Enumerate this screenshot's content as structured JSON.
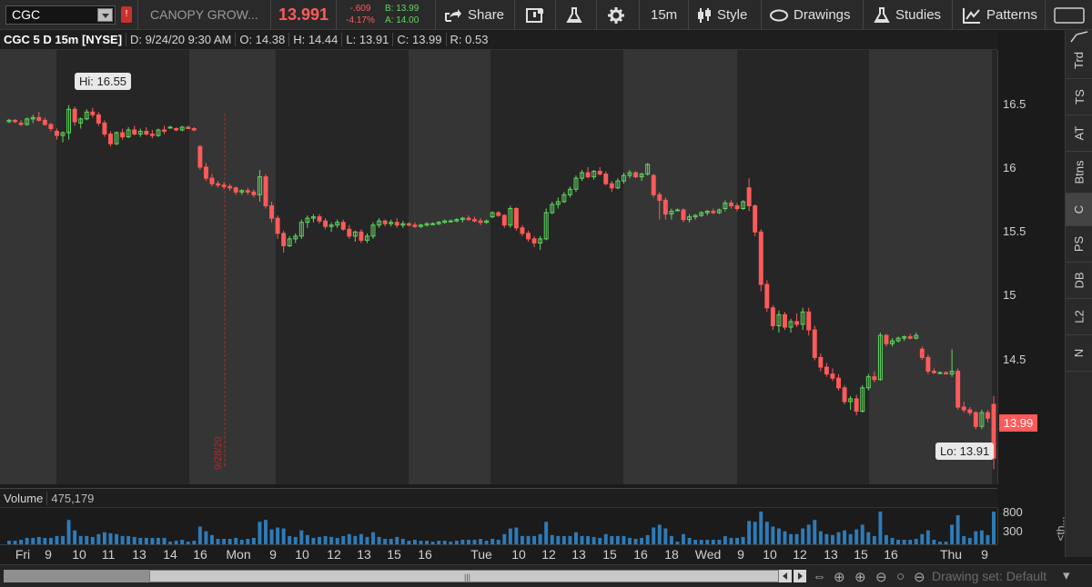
{
  "toolbar": {
    "symbol": "CGC",
    "company": "CANOPY GROW...",
    "last_price": "13.991",
    "change": "-.609",
    "change_pct": "-4.17%",
    "bid": "B: 13.99",
    "ask": "A: 14.00",
    "share_label": "Share",
    "interval_label": "15m",
    "style_label": "Style",
    "drawings_label": "Drawings",
    "studies_label": "Studies",
    "patterns_label": "Patterns",
    "colors": {
      "up": "#5fd85f",
      "down": "#ff5a5a"
    }
  },
  "infobar": {
    "symbol": "CGC 5 D 15m [NYSE]",
    "date": "D: 9/24/20 9:30 AM",
    "open": "O: 14.38",
    "high": "H: 14.44",
    "low": "L: 13.91",
    "close": "C: 13.99",
    "range": "R: 0.53"
  },
  "right_rail": [
    "Trd",
    "TS",
    "AT",
    "Btns",
    "C",
    "PS",
    "DB",
    "L2",
    "N"
  ],
  "price_axis": [
    "16.5",
    "16",
    "15.5",
    "15",
    "14.5"
  ],
  "price_flag": "13.99",
  "hi_label": "Hi: 16.55",
  "lo_label": "Lo: 13.91",
  "date_marker": "9/28/20",
  "volume": {
    "label": "Volume",
    "value": "475,179",
    "axis": [
      "800",
      "300"
    ],
    "collapse_label": "<th..."
  },
  "time_axis": [
    "Fri",
    "9",
    "10",
    "11",
    "13",
    "14",
    "16",
    "Mon",
    "9",
    "10",
    "12",
    "13",
    "15",
    "16",
    "Tue",
    "10",
    "12",
    "13",
    "15",
    "16",
    "18",
    "Wed",
    "9",
    "10",
    "12",
    "13",
    "15",
    "16",
    "Thu",
    "9"
  ],
  "bottom": {
    "drawing_set": "Drawing set: Default"
  },
  "chart_data": {
    "type": "candlestick",
    "symbol": "CGC",
    "interval": "15m",
    "ylim": [
      13.8,
      16.95
    ],
    "sessions": [
      "Fri",
      "Mon",
      "Tue",
      "Wed",
      "Thu"
    ],
    "points": [
      [
        16.43,
        16.45,
        16.42,
        16.44
      ],
      [
        16.44,
        16.45,
        16.42,
        16.43
      ],
      [
        16.42,
        16.44,
        16.4,
        16.41
      ],
      [
        16.41,
        16.46,
        16.4,
        16.45
      ],
      [
        16.45,
        16.48,
        16.42,
        16.46
      ],
      [
        16.46,
        16.5,
        16.43,
        16.44
      ],
      [
        16.44,
        16.46,
        16.4,
        16.41
      ],
      [
        16.41,
        16.42,
        16.36,
        16.38
      ],
      [
        16.36,
        16.38,
        16.3,
        16.33
      ],
      [
        16.33,
        16.36,
        16.28,
        16.35
      ],
      [
        16.35,
        16.55,
        16.3,
        16.52
      ],
      [
        16.52,
        16.54,
        16.4,
        16.43
      ],
      [
        16.42,
        16.46,
        16.38,
        16.45
      ],
      [
        16.45,
        16.52,
        16.44,
        16.5
      ],
      [
        16.5,
        16.53,
        16.46,
        16.48
      ],
      [
        16.48,
        16.5,
        16.4,
        16.42
      ],
      [
        16.42,
        16.44,
        16.32,
        16.34
      ],
      [
        16.34,
        16.36,
        16.25,
        16.27
      ],
      [
        16.27,
        16.36,
        16.26,
        16.35
      ],
      [
        16.35,
        16.38,
        16.3,
        16.32
      ],
      [
        16.32,
        16.39,
        16.31,
        16.37
      ],
      [
        16.37,
        16.4,
        16.33,
        16.34
      ],
      [
        16.34,
        16.38,
        16.32,
        16.36
      ],
      [
        16.36,
        16.39,
        16.33,
        16.34
      ],
      [
        16.34,
        16.37,
        16.31,
        16.33
      ],
      [
        16.33,
        16.38,
        16.32,
        16.37
      ],
      [
        16.37,
        16.4,
        16.34,
        16.36
      ],
      [
        16.39,
        16.4,
        16.38,
        16.39
      ],
      [
        16.38,
        16.39,
        16.36,
        16.37
      ],
      [
        16.37,
        16.4,
        16.36,
        16.39
      ],
      [
        16.39,
        16.4,
        16.38,
        16.38
      ],
      [
        16.38,
        16.39,
        16.36,
        16.37
      ],
      [
        16.25,
        16.26,
        16.08,
        16.1
      ],
      [
        16.1,
        16.13,
        16.0,
        16.02
      ],
      [
        16.02,
        16.05,
        15.96,
        15.98
      ],
      [
        15.98,
        16.0,
        15.95,
        15.97
      ],
      [
        15.97,
        15.99,
        15.94,
        15.96
      ],
      [
        15.96,
        15.98,
        15.93,
        15.95
      ],
      [
        15.95,
        15.96,
        15.9,
        15.92
      ],
      [
        15.92,
        15.94,
        15.9,
        15.93
      ],
      [
        15.93,
        15.95,
        15.9,
        15.92
      ],
      [
        15.92,
        15.94,
        15.88,
        15.9
      ],
      [
        15.9,
        16.08,
        15.85,
        16.03
      ],
      [
        16.03,
        16.05,
        15.8,
        15.82
      ],
      [
        15.82,
        15.85,
        15.7,
        15.73
      ],
      [
        15.73,
        15.75,
        15.58,
        15.62
      ],
      [
        15.62,
        15.64,
        15.48,
        15.53
      ],
      [
        15.53,
        15.6,
        15.52,
        15.58
      ],
      [
        15.58,
        15.62,
        15.55,
        15.6
      ],
      [
        15.6,
        15.72,
        15.58,
        15.7
      ],
      [
        15.7,
        15.75,
        15.66,
        15.73
      ],
      [
        15.73,
        15.76,
        15.7,
        15.74
      ],
      [
        15.74,
        15.76,
        15.69,
        15.71
      ],
      [
        15.71,
        15.73,
        15.65,
        15.67
      ],
      [
        15.67,
        15.7,
        15.63,
        15.68
      ],
      [
        15.68,
        15.72,
        15.66,
        15.7
      ],
      [
        15.7,
        15.72,
        15.64,
        15.65
      ],
      [
        15.65,
        15.68,
        15.58,
        15.6
      ],
      [
        15.6,
        15.64,
        15.56,
        15.63
      ],
      [
        15.63,
        15.65,
        15.55,
        15.57
      ],
      [
        15.57,
        15.62,
        15.55,
        15.6
      ],
      [
        15.6,
        15.7,
        15.58,
        15.68
      ],
      [
        15.68,
        15.73,
        15.66,
        15.71
      ],
      [
        15.71,
        15.72,
        15.67,
        15.69
      ],
      [
        15.69,
        15.72,
        15.67,
        15.7
      ],
      [
        15.7,
        15.73,
        15.66,
        15.68
      ],
      [
        15.68,
        15.71,
        15.66,
        15.69
      ],
      [
        15.69,
        15.7,
        15.67,
        15.68
      ],
      [
        15.68,
        15.7,
        15.66,
        15.67
      ],
      [
        15.67,
        15.69,
        15.66,
        15.68
      ],
      [
        15.68,
        15.7,
        15.67,
        15.69
      ],
      [
        15.69,
        15.7,
        15.68,
        15.69
      ],
      [
        15.69,
        15.71,
        15.68,
        15.7
      ],
      [
        15.7,
        15.72,
        15.69,
        15.71
      ],
      [
        15.71,
        15.72,
        15.7,
        15.71
      ],
      [
        15.71,
        15.73,
        15.7,
        15.72
      ],
      [
        15.72,
        15.74,
        15.7,
        15.73
      ],
      [
        15.73,
        15.75,
        15.71,
        15.72
      ],
      [
        15.72,
        15.74,
        15.7,
        15.71
      ],
      [
        15.71,
        15.73,
        15.68,
        15.7
      ],
      [
        15.7,
        15.72,
        15.69,
        15.71
      ],
      [
        15.74,
        15.78,
        15.73,
        15.77
      ],
      [
        15.77,
        15.78,
        15.74,
        15.75
      ],
      [
        15.75,
        15.76,
        15.66,
        15.68
      ],
      [
        15.68,
        15.82,
        15.66,
        15.8
      ],
      [
        15.8,
        15.81,
        15.64,
        15.66
      ],
      [
        15.66,
        15.68,
        15.6,
        15.62
      ],
      [
        15.62,
        15.64,
        15.56,
        15.58
      ],
      [
        15.58,
        15.6,
        15.52,
        15.55
      ],
      [
        15.55,
        15.6,
        15.5,
        15.58
      ],
      [
        15.58,
        15.8,
        15.57,
        15.77
      ],
      [
        15.77,
        15.85,
        15.76,
        15.83
      ],
      [
        15.83,
        15.88,
        15.8,
        15.85
      ],
      [
        15.85,
        15.92,
        15.84,
        15.9
      ],
      [
        15.9,
        15.96,
        15.88,
        15.94
      ],
      [
        15.94,
        16.04,
        15.92,
        16.02
      ],
      [
        16.02,
        16.08,
        16.0,
        16.06
      ],
      [
        16.06,
        16.1,
        16.02,
        16.03
      ],
      [
        16.03,
        16.08,
        16.01,
        16.07
      ],
      [
        16.07,
        16.1,
        16.04,
        16.05
      ],
      [
        16.05,
        16.07,
        15.97,
        15.98
      ],
      [
        15.98,
        16.0,
        15.92,
        15.95
      ],
      [
        15.95,
        16.02,
        15.94,
        16.0
      ],
      [
        16.0,
        16.06,
        15.98,
        16.04
      ],
      [
        16.04,
        16.08,
        16.02,
        16.06
      ],
      [
        16.06,
        16.07,
        16.02,
        16.03
      ],
      [
        16.03,
        16.06,
        16.0,
        16.05
      ],
      [
        16.05,
        16.13,
        16.04,
        16.12
      ],
      [
        16.04,
        16.05,
        15.88,
        15.9
      ],
      [
        15.9,
        15.92,
        15.72,
        15.86
      ],
      [
        15.86,
        15.88,
        15.72,
        15.76
      ],
      [
        15.76,
        15.8,
        15.72,
        15.78
      ],
      [
        15.79,
        15.8,
        15.78,
        15.79
      ],
      [
        15.79,
        15.8,
        15.7,
        15.72
      ],
      [
        15.72,
        15.76,
        15.7,
        15.74
      ],
      [
        15.74,
        15.76,
        15.72,
        15.75
      ],
      [
        15.75,
        15.78,
        15.74,
        15.77
      ],
      [
        15.77,
        15.79,
        15.75,
        15.78
      ],
      [
        15.78,
        15.8,
        15.76,
        15.77
      ],
      [
        15.77,
        15.8,
        15.76,
        15.79
      ],
      [
        15.8,
        15.86,
        15.78,
        15.84
      ],
      [
        15.84,
        15.86,
        15.8,
        15.82
      ],
      [
        15.82,
        15.84,
        15.78,
        15.8
      ],
      [
        15.8,
        15.86,
        15.79,
        15.85
      ],
      [
        15.95,
        16.02,
        15.78,
        15.82
      ],
      [
        15.82,
        15.83,
        15.6,
        15.63
      ],
      [
        15.63,
        15.65,
        15.2,
        15.25
      ],
      [
        15.25,
        15.28,
        15.05,
        15.08
      ],
      [
        15.08,
        15.1,
        14.92,
        14.95
      ],
      [
        14.95,
        15.06,
        14.9,
        15.03
      ],
      [
        15.03,
        15.05,
        14.92,
        14.94
      ],
      [
        14.94,
        15.0,
        14.9,
        14.98
      ],
      [
        14.98,
        15.04,
        14.94,
        14.96
      ],
      [
        14.96,
        15.08,
        14.92,
        15.05
      ],
      [
        15.05,
        15.08,
        14.88,
        14.92
      ],
      [
        14.92,
        14.95,
        14.7,
        14.72
      ],
      [
        14.72,
        14.75,
        14.62,
        14.65
      ],
      [
        14.65,
        14.68,
        14.58,
        14.6
      ],
      [
        14.6,
        14.64,
        14.55,
        14.57
      ],
      [
        14.57,
        14.6,
        14.48,
        14.5
      ],
      [
        14.5,
        14.52,
        14.38,
        14.4
      ],
      [
        14.4,
        14.44,
        14.34,
        14.42
      ],
      [
        14.42,
        14.45,
        14.3,
        14.33
      ],
      [
        14.33,
        14.52,
        14.32,
        14.5
      ],
      [
        14.5,
        14.6,
        14.48,
        14.58
      ],
      [
        14.58,
        14.62,
        14.54,
        14.56
      ],
      [
        14.56,
        14.9,
        14.55,
        14.88
      ],
      [
        14.88,
        14.89,
        14.8,
        14.82
      ],
      [
        14.82,
        14.86,
        14.8,
        14.84
      ],
      [
        14.84,
        14.87,
        14.83,
        14.86
      ],
      [
        14.86,
        14.88,
        14.84,
        14.87
      ],
      [
        14.87,
        14.89,
        14.85,
        14.86
      ],
      [
        14.86,
        14.9,
        14.85,
        14.88
      ],
      [
        14.78,
        14.8,
        14.7,
        14.72
      ],
      [
        14.72,
        14.74,
        14.6,
        14.62
      ],
      [
        14.62,
        14.64,
        14.6,
        14.61
      ],
      [
        14.61,
        14.62,
        14.6,
        14.61
      ],
      [
        14.61,
        14.62,
        14.6,
        14.6
      ],
      [
        14.6,
        14.78,
        14.58,
        14.62
      ],
      [
        14.62,
        14.64,
        14.34,
        14.36
      ],
      [
        14.36,
        14.4,
        14.32,
        14.34
      ],
      [
        14.34,
        14.36,
        14.3,
        14.32
      ],
      [
        14.32,
        14.33,
        14.2,
        14.22
      ],
      [
        14.22,
        14.34,
        14.2,
        14.32
      ],
      [
        14.32,
        14.34,
        14.25,
        14.28
      ],
      [
        14.38,
        14.44,
        13.91,
        13.99
      ]
    ]
  }
}
